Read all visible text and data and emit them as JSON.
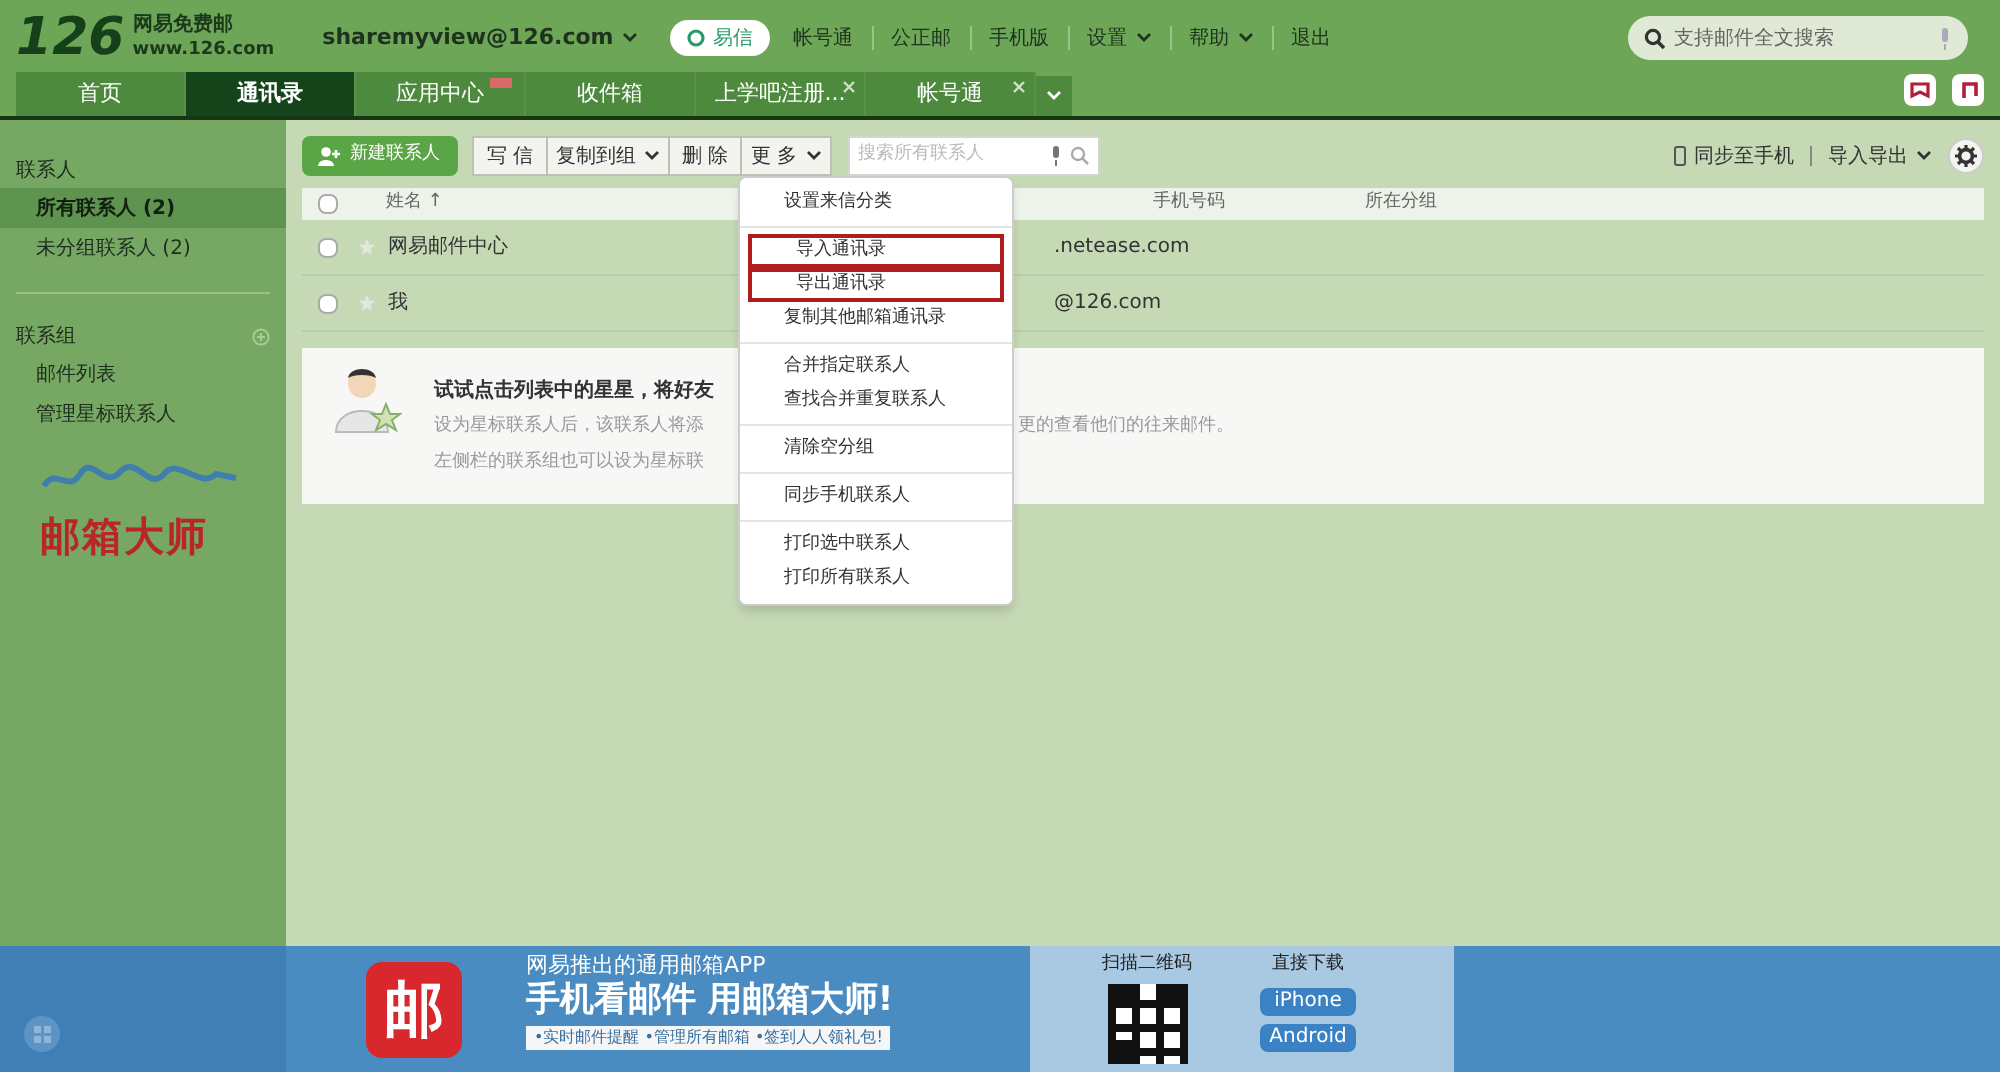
{
  "header": {
    "logo_number": "126",
    "logo_name": "网易免费邮",
    "logo_url": "www.126.com",
    "account": "sharemyview@126.com",
    "yixin": "易信",
    "links": [
      {
        "label": "帐号通",
        "dropdown": false
      },
      {
        "label": "公正邮",
        "dropdown": false
      },
      {
        "label": "手机版",
        "dropdown": false
      },
      {
        "label": "设置",
        "dropdown": true
      },
      {
        "label": "帮助",
        "dropdown": true
      },
      {
        "label": "退出",
        "dropdown": false
      }
    ],
    "search": {
      "placeholder": "支持邮件全文搜索"
    }
  },
  "tabs": [
    {
      "label": "首页",
      "selected": false,
      "closable": false,
      "badge": false
    },
    {
      "label": "通讯录",
      "selected": true,
      "closable": false,
      "badge": false
    },
    {
      "label": "应用中心",
      "selected": false,
      "closable": false,
      "badge": true
    },
    {
      "label": "收件箱",
      "selected": false,
      "closable": false,
      "badge": false
    },
    {
      "label": "上学吧注册...",
      "selected": false,
      "closable": true,
      "badge": false
    },
    {
      "label": "帐号通",
      "selected": false,
      "closable": true,
      "badge": false
    }
  ],
  "sidebar": {
    "sections": [
      {
        "title": "联系人",
        "add": false,
        "items": [
          {
            "label": "所有联系人 (2)",
            "selected": true
          },
          {
            "label": "未分组联系人 (2)",
            "selected": false
          }
        ]
      },
      {
        "title": "联系组",
        "add": true,
        "items": [
          {
            "label": "邮件列表",
            "selected": false
          },
          {
            "label": "管理星标联系人",
            "selected": false
          }
        ]
      }
    ],
    "promo": "邮箱大师"
  },
  "toolbar": {
    "new_contact": "新建联系人",
    "buttons": [
      {
        "label": "写 信",
        "dropdown": false
      },
      {
        "label": "复制到组",
        "dropdown": true
      },
      {
        "label": "删 除",
        "dropdown": false
      },
      {
        "label": "更 多",
        "dropdown": true
      }
    ],
    "search": {
      "placeholder": "搜索所有联系人"
    },
    "sync": "同步至手机",
    "import_export": "导入导出"
  },
  "table": {
    "select_all_checked": false,
    "columns": [
      "姓名 ↑",
      "手机号码",
      "所在分组"
    ],
    "rows": [
      {
        "name": "网易邮件中心",
        "starred": false,
        "checked": false,
        "email": ".netease.com"
      },
      {
        "name": "我",
        "starred": false,
        "checked": false,
        "email": "@126.com"
      }
    ]
  },
  "tip": {
    "title": "试试点击列表中的星星，将好友",
    "line_1": "设为星标联系人后，该联系人将添",
    "line_1_end": "更的查看他们的往来邮件。",
    "line_2": "左侧栏的联系组也可以设为星标联"
  },
  "menu": {
    "groups": [
      [
        {
          "label": "设置来信分类",
          "highlighted": false
        }
      ],
      [
        {
          "label": "导入通讯录",
          "highlighted": true
        },
        {
          "label": "导出通讯录",
          "highlighted": true
        },
        {
          "label": "复制其他邮箱通讯录",
          "highlighted": false
        }
      ],
      [
        {
          "label": "合并指定联系人",
          "highlighted": false
        },
        {
          "label": "查找合并重复联系人",
          "highlighted": false
        }
      ],
      [
        {
          "label": "清除空分组",
          "highlighted": false
        }
      ],
      [
        {
          "label": "同步手机联系人",
          "highlighted": false
        }
      ],
      [
        {
          "label": "打印选中联系人",
          "highlighted": false
        },
        {
          "label": "打印所有联系人",
          "highlighted": false
        }
      ]
    ]
  },
  "banner": {
    "app_icon": "邮",
    "kicker": "网易推出的通用邮箱APP",
    "headline": "手机看邮件 用邮箱大师!",
    "features": "•实时邮件提醒 •管理所有邮箱 •签到人人领礼包!",
    "qr_label": "扫描二维码",
    "download_label": "直接下载",
    "downloads": [
      "iPhone",
      "Android"
    ]
  }
}
